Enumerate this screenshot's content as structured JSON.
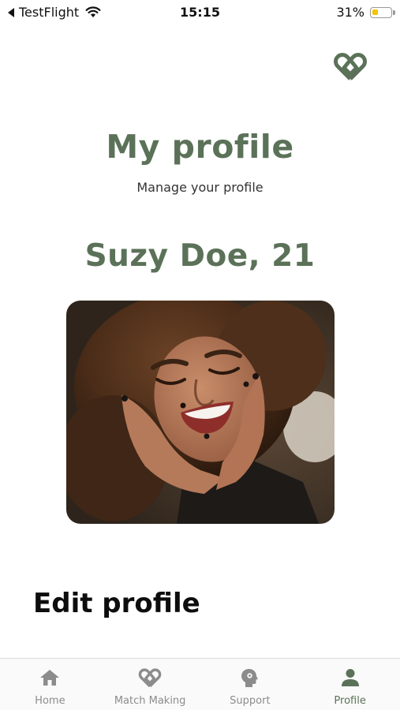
{
  "colors": {
    "brand_green": "#5b7258",
    "inactive_gray": "#8c8c8c",
    "battery_yellow": "#f5c400"
  },
  "status_bar": {
    "back_app": "TestFlight",
    "time": "15:15",
    "battery_percent": "31%",
    "battery_level": 0.31,
    "icons": [
      "back-caret-icon",
      "wifi-icon",
      "battery-icon"
    ]
  },
  "header": {
    "logo_icon": "heart-interlock-logo-icon"
  },
  "profile": {
    "title": "My profile",
    "subtitle": "Manage your profile",
    "name_age": "Suzy Doe, 21",
    "photo": "profile-photo-smiling-woman"
  },
  "edit_section": {
    "heading": "Edit profile"
  },
  "tab_bar": {
    "tabs": [
      {
        "label": "Home",
        "icon": "home-icon",
        "active": false
      },
      {
        "label": "Match Making",
        "icon": "heart-interlock-icon",
        "active": false
      },
      {
        "label": "Support",
        "icon": "head-brain-icon",
        "active": false
      },
      {
        "label": "Profile",
        "icon": "person-icon",
        "active": true
      }
    ]
  }
}
